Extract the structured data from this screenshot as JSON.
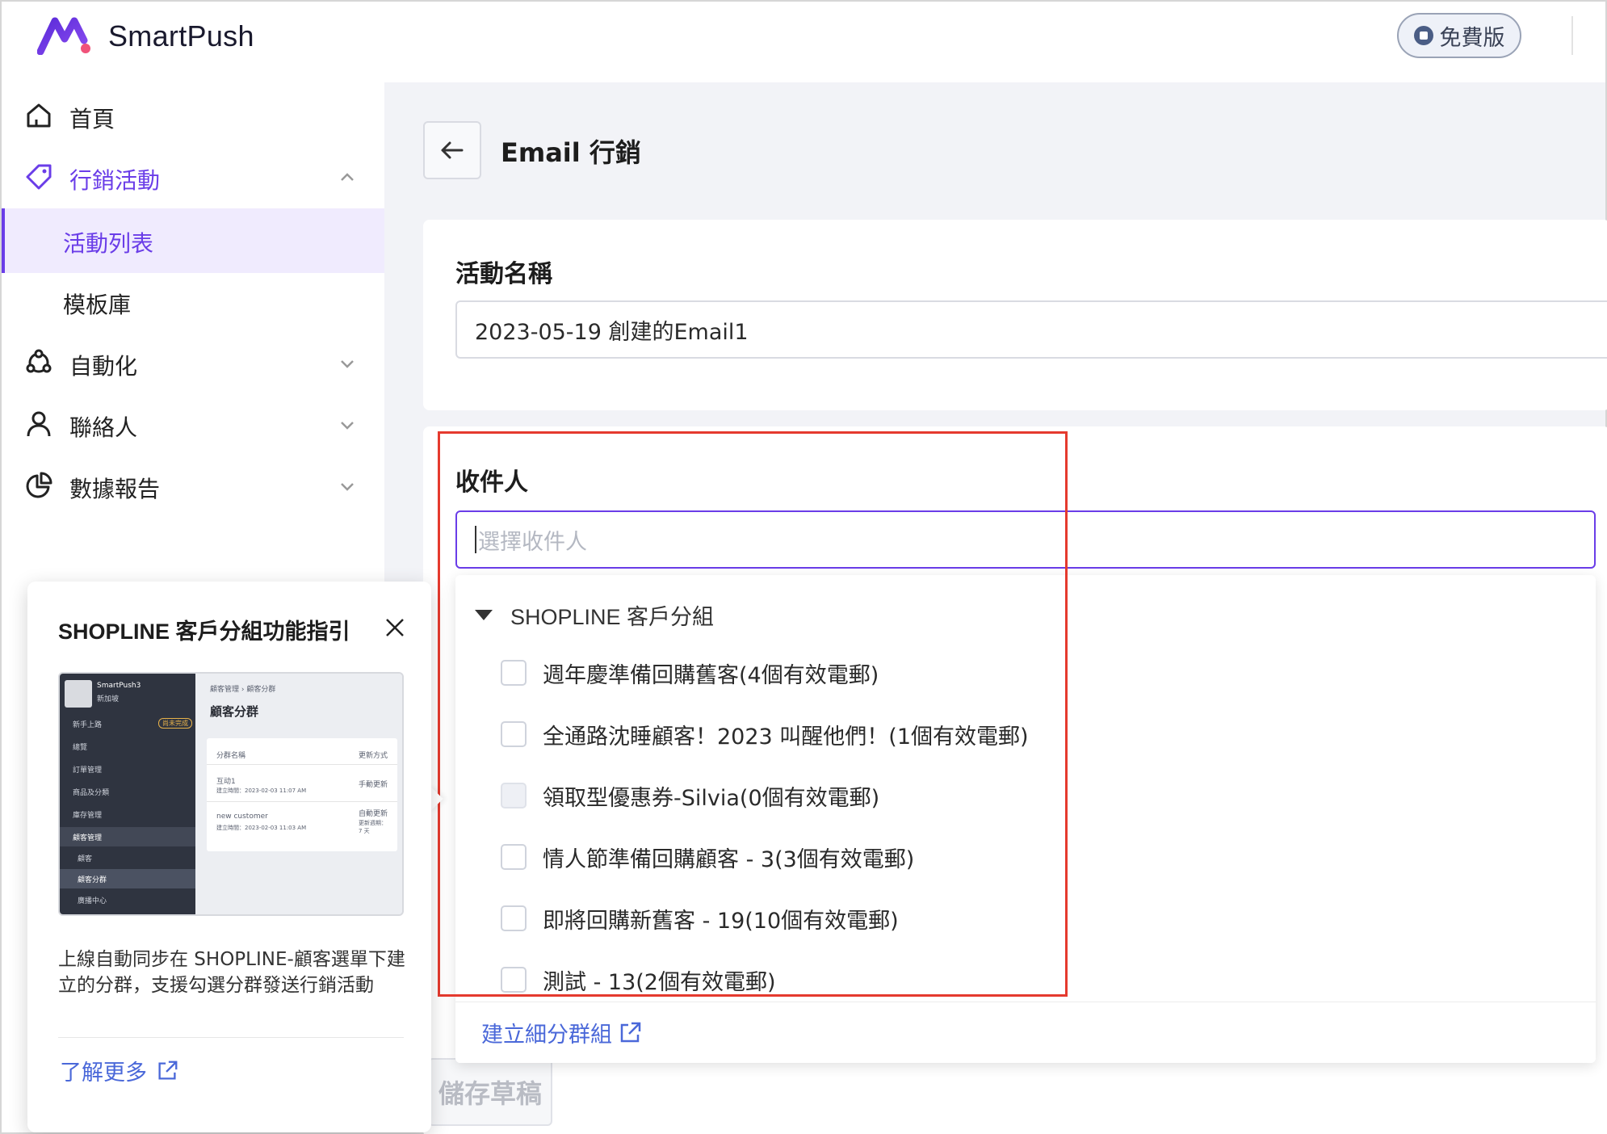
{
  "header": {
    "brand": "SmartPush",
    "plan_badge": "免費版"
  },
  "sidebar": {
    "items": [
      {
        "label": "首頁",
        "icon": "home-icon"
      },
      {
        "label": "行銷活動",
        "icon": "tag-icon",
        "expanded": true
      },
      {
        "label": "活動列表",
        "selected": true
      },
      {
        "label": "模板庫"
      },
      {
        "label": "自動化",
        "icon": "automation-icon"
      },
      {
        "label": "聯絡人",
        "icon": "person-icon"
      },
      {
        "label": "數據報告",
        "icon": "pie-chart-icon"
      }
    ]
  },
  "main": {
    "title": "Email 行銷",
    "campaign_name": {
      "label": "活動名稱",
      "value": "2023-05-19 創建的Email1"
    },
    "recipients": {
      "label": "收件人",
      "placeholder": "選擇收件人"
    },
    "save_draft": "儲存草稿"
  },
  "dropdown": {
    "group": "SHOPLINE 客戶分組",
    "options": [
      {
        "label": "週年慶準備回購舊客(4個有效電郵)",
        "disabled": false
      },
      {
        "label": "全通路沈睡顧客！2023 叫醒他們！(1個有效電郵)",
        "disabled": false
      },
      {
        "label": "領取型優惠券-Silvia(0個有效電郵)",
        "disabled": true
      },
      {
        "label": "情人節準備回購顧客 - 3(3個有效電郵)",
        "disabled": false
      },
      {
        "label": "即將回購新舊客 - 19(10個有效電郵)",
        "disabled": false
      },
      {
        "label": "測試 - 13(2個有效電郵)",
        "disabled": false
      }
    ],
    "create_link": "建立細分群組"
  },
  "guide": {
    "title": "SHOPLINE 客戶分組功能指引",
    "screenshot": {
      "store_name": "SmartPush3",
      "store_sub": "新加坡",
      "menu": [
        "新手上路",
        "總覽",
        "訂單管理",
        "商品及分類",
        "庫存管理",
        "顧客管理",
        "顧客",
        "顧客分群",
        "廣播中心"
      ],
      "badge": "尚未完成",
      "breadcrumb": "顧客管理  ›  顧客分群",
      "heading": "顧客分群",
      "col_name": "分群名稱",
      "col_update": "更新方式",
      "row1_name": "互动1",
      "row1_time": "建立時間：2023-02-03 11:07 AM",
      "row1_update": "手動更新",
      "row2_name": "new customer",
      "row2_time": "建立時間：2023-02-03 11:03 AM",
      "row2_update": "自動更新",
      "row2_update_sub": "更新週期：",
      "row2_update_days": "7 天"
    },
    "description": "上線自動同步在 SHOPLINE-顧客選單下建立的分群，支援勾選分群發送行銷活動",
    "learn_more": "了解更多"
  },
  "colors": {
    "accent": "#6a3de8",
    "link": "#4a68d9",
    "highlight": "#e53a2e",
    "background": "#f2f3f7"
  }
}
